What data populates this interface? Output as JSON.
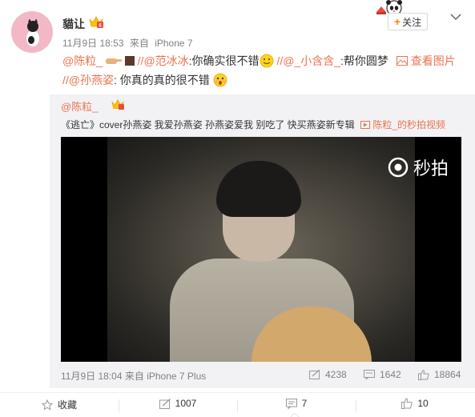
{
  "post": {
    "username": "貓让",
    "time": "11月9日 18:53",
    "source_prefix": "来自",
    "source": "iPhone 7",
    "follow_label": "关注",
    "line1": {
      "m1": "@陈粒_",
      "m2": "//@范冰冰",
      "t2": ":你确实很不错",
      "m3": "//@_小含含_",
      "t3": ":帮你圆梦",
      "image_link": "查看图片"
    },
    "line2": {
      "m1": "//@孙燕姿",
      "t1": ": 你真的真的很不错"
    }
  },
  "repost": {
    "username": "@陈粒_",
    "text": "《逃亡》cover孙燕姿 我爱孙燕姿 孙燕姿爱我 别吃了 快买燕姿新专辑",
    "video_link": "陈粒_的秒拍视频",
    "watermark": "秒拍",
    "time": "11月9日 18:04",
    "source_prefix": "来自",
    "source": "iPhone 7 Plus",
    "reposts": "4238",
    "comments": "1642",
    "likes": "18864"
  },
  "actions": {
    "favorite": "收藏",
    "repost": "1007",
    "comment": "7",
    "like": "10"
  },
  "colors": {
    "accent": "#eb7350",
    "follow_plus": "#ff8200",
    "meta_gray": "#808080",
    "repost_bg": "#f2f2f5"
  }
}
